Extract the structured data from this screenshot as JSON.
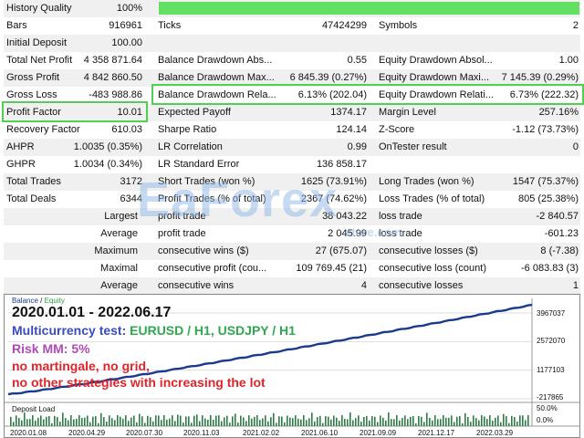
{
  "history_quality": {
    "label": "History Quality",
    "value": "100%",
    "percent": 100
  },
  "rows": [
    {
      "c1": [
        "Bars",
        "916961"
      ],
      "c2": [
        "Ticks",
        "47424299"
      ],
      "c3": [
        "Symbols",
        "2"
      ]
    },
    {
      "c1": [
        "Initial Deposit",
        "100.00"
      ],
      "c2": [
        "",
        ""
      ],
      "c3": [
        "",
        ""
      ]
    },
    {
      "c1": [
        "Total Net Profit",
        "4 358 871.64"
      ],
      "c2": [
        "Balance Drawdown Abs...",
        "0.55"
      ],
      "c3": [
        "Equity Drawdown Absol...",
        "1.00"
      ]
    },
    {
      "c1": [
        "Gross Profit",
        "4 842 860.50"
      ],
      "c2": [
        "Balance Drawdown Max...",
        "6 845.39 (0.27%)"
      ],
      "c3": [
        "Equity Drawdown Maxi...",
        "7 145.39 (0.29%)"
      ]
    },
    {
      "c1": [
        "Gross Loss",
        "-483 988.86"
      ],
      "c2": [
        "Balance Drawdown Rela...",
        "6.13% (202.04)"
      ],
      "c3": [
        "Equity Drawdown Relati...",
        "6.73% (222.32)"
      ]
    },
    {
      "c1": [
        "Profit Factor",
        "10.01"
      ],
      "c2": [
        "Expected Payoff",
        "1374.17"
      ],
      "c3": [
        "Margin Level",
        "257.16%"
      ]
    },
    {
      "c1": [
        "Recovery Factor",
        "610.03"
      ],
      "c2": [
        "Sharpe Ratio",
        "124.14"
      ],
      "c3": [
        "Z-Score",
        "-1.12 (73.73%)"
      ]
    },
    {
      "c1": [
        "AHPR",
        "1.0035 (0.35%)"
      ],
      "c2": [
        "LR Correlation",
        "0.99"
      ],
      "c3": [
        "OnTester result",
        "0"
      ]
    },
    {
      "c1": [
        "GHPR",
        "1.0034 (0.34%)"
      ],
      "c2": [
        "LR Standard Error",
        "136 858.17"
      ],
      "c3": [
        "",
        ""
      ]
    },
    {
      "c1": [
        "Total Trades",
        "3172"
      ],
      "c2": [
        "Short Trades (won %)",
        "1625 (73.91%)"
      ],
      "c3": [
        "Long Trades (won %)",
        "1547 (75.37%)"
      ]
    },
    {
      "c1": [
        "Total Deals",
        "6344"
      ],
      "c2": [
        "Profit Trades (% of total)",
        "2367 (74.62%)"
      ],
      "c3": [
        "Loss Trades (% of total)",
        "805 (25.38%)"
      ]
    },
    {
      "c1": [
        "Largest",
        ""
      ],
      "c2": [
        "profit trade",
        "38 043.22"
      ],
      "c3": [
        "loss trade",
        "-2 840.57"
      ]
    },
    {
      "c1": [
        "Average",
        ""
      ],
      "c2": [
        "profit trade",
        "2 045.99"
      ],
      "c3": [
        "loss trade",
        "-601.23"
      ]
    },
    {
      "c1": [
        "Maximum",
        ""
      ],
      "c2": [
        "consecutive wins ($)",
        "27 (675.07)"
      ],
      "c3": [
        "consecutive losses ($)",
        "8 (-7.38)"
      ]
    },
    {
      "c1": [
        "Maximal",
        ""
      ],
      "c2": [
        "consecutive profit (cou...",
        "109 769.45 (21)"
      ],
      "c3": [
        "consecutive loss (count)",
        "-6 083.83 (3)"
      ]
    },
    {
      "c1": [
        "Average",
        ""
      ],
      "c2": [
        "consecutive wins",
        "4"
      ],
      "c3": [
        "consecutive losses",
        "1"
      ]
    }
  ],
  "watermark": {
    "brand": "EaForex",
    "sub": "store.com"
  },
  "chart": {
    "legend_balance": "Balance",
    "legend_sep": " / ",
    "legend_equity": "Equity",
    "colors": {
      "balance": "#1a3a8c",
      "equity": "#2ea043",
      "blue_text": "#3a4bbf",
      "green_text": "#2fa84f",
      "purple_text": "#b04ab8",
      "red_text": "#e0242a",
      "highlight": "#4fd04f"
    },
    "date_range": "2020.01.01 - 2022.06.17",
    "multicurrency_label": "Multicurrency test:",
    "multicurrency_pairs": "EURUSD / H1, USDJPY / H1",
    "risk": "Risk MM: 5%",
    "note1": "no martingale, no grid,",
    "note2": "no other strategies with increasing the lot",
    "y_labels": [
      "3967037",
      "2572070",
      "1177103",
      "-217865"
    ],
    "deposit_load_label": "Deposit Load",
    "load_labels": [
      "50.0%",
      "0.0%"
    ],
    "x_labels": [
      "2020.01.08",
      "2020.04.29",
      "2020.07.30",
      "2020.11.03",
      "2021.02.02",
      "2021.06.10",
      "2021.09.09",
      "2021.12.17",
      "2022.03.29"
    ]
  },
  "chart_data": {
    "type": "line",
    "x": [
      "2020.01.08",
      "2020.04.29",
      "2020.07.30",
      "2020.11.03",
      "2021.02.02",
      "2021.06.10",
      "2021.09.09",
      "2021.12.17",
      "2022.03.29",
      "2022.06.17"
    ],
    "series": [
      {
        "name": "Balance",
        "values": [
          100,
          250000,
          520000,
          980000,
          1450000,
          1950000,
          2500000,
          3000000,
          3600000,
          4358971
        ]
      },
      {
        "name": "Equity",
        "values": [
          100,
          250000,
          520000,
          980000,
          1450000,
          1950000,
          2500000,
          3000000,
          3600000,
          4358971
        ]
      }
    ],
    "yticks": [
      3967037,
      2572070,
      1177103,
      -217865
    ],
    "ylim": [
      -217865,
      4500000
    ]
  }
}
